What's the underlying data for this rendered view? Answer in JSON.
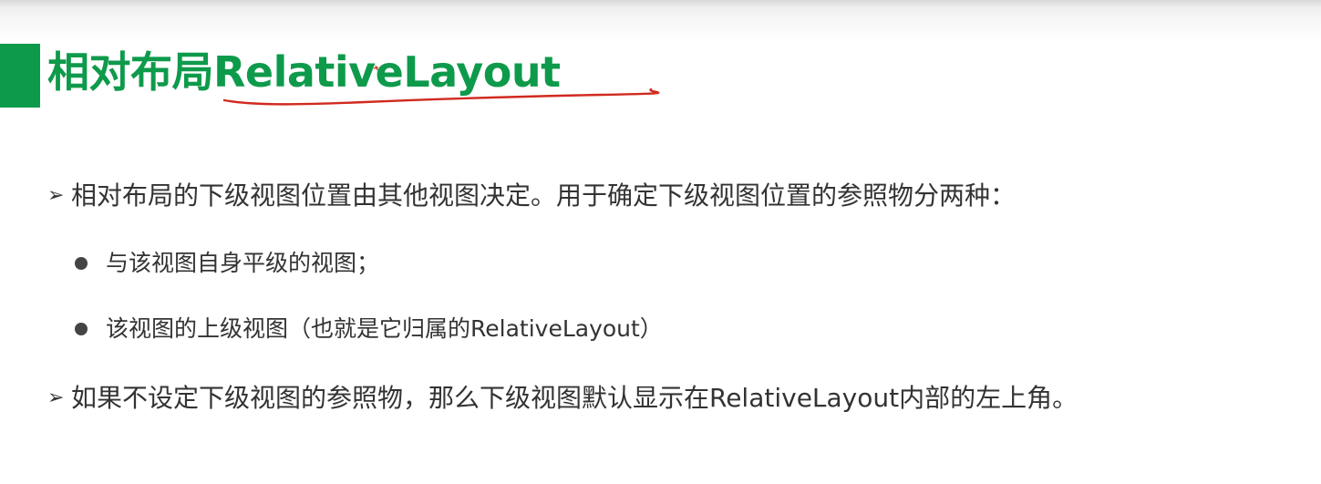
{
  "title": "相对布局RelativeLayout",
  "bullets": [
    {
      "marker": "➢",
      "text": "相对布局的下级视图位置由其他视图决定。用于确定下级视图位置的参照物分两种："
    },
    {
      "marker": "➢",
      "text": "如果不设定下级视图的参照物，那么下级视图默认显示在RelativeLayout内部的左上角。"
    }
  ],
  "sub_bullets": [
    {
      "text": "与该视图自身平级的视图；"
    },
    {
      "text": "该视图的上级视图（也就是它归属的RelativeLayout）"
    }
  ],
  "colors": {
    "accent": "#0e9a4b",
    "annotation": "#d12a1f",
    "text": "#333333"
  }
}
